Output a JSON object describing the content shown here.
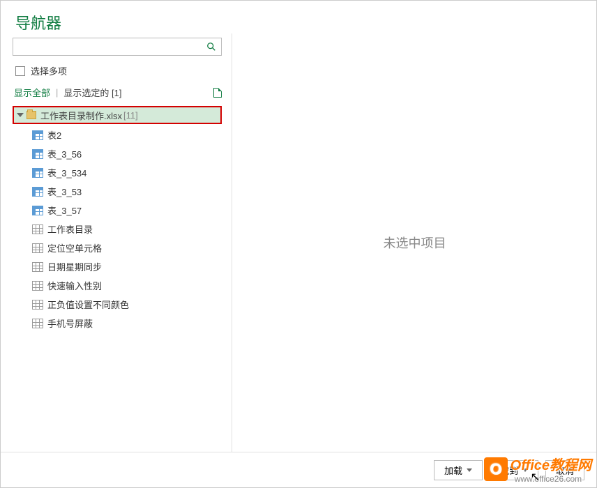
{
  "header": {
    "title": "导航器"
  },
  "search": {
    "value": "",
    "placeholder": ""
  },
  "options": {
    "multiSelectLabel": "选择多项"
  },
  "filter": {
    "showAll": "显示全部",
    "showSelected": "显示选定的 [1]"
  },
  "tree": {
    "root": {
      "label": "工作表目录制作.xlsx",
      "count": "[11]"
    },
    "items": [
      {
        "label": "表2",
        "type": "table"
      },
      {
        "label": "表_3_56",
        "type": "table"
      },
      {
        "label": "表_3_534",
        "type": "table"
      },
      {
        "label": "表_3_53",
        "type": "table"
      },
      {
        "label": "表_3_57",
        "type": "table"
      },
      {
        "label": "工作表目录",
        "type": "sheet"
      },
      {
        "label": "定位空单元格",
        "type": "sheet"
      },
      {
        "label": "日期星期同步",
        "type": "sheet"
      },
      {
        "label": "快速输入性别",
        "type": "sheet"
      },
      {
        "label": "正负值设置不同颜色",
        "type": "sheet"
      },
      {
        "label": "手机号屏蔽",
        "type": "sheet"
      }
    ]
  },
  "preview": {
    "placeholder": "未选中项目"
  },
  "footer": {
    "load": "加载",
    "loadTo": "载到",
    "cancel": "取消"
  },
  "watermark": {
    "brand": "Office教程网",
    "url": "www.office26.com"
  }
}
